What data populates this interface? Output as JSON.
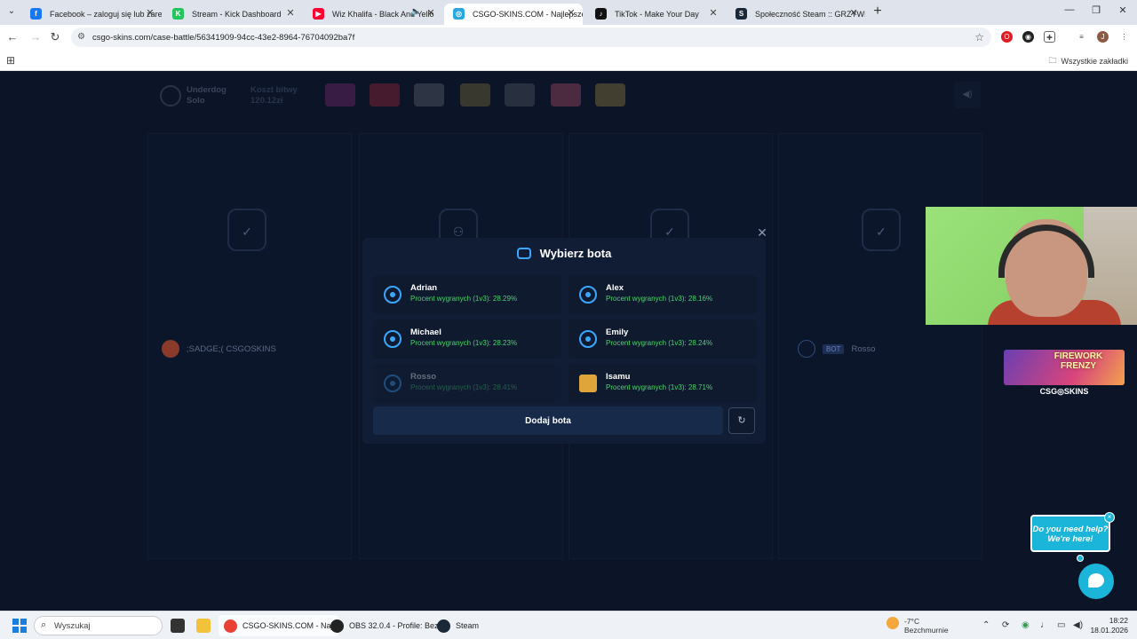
{
  "browser": {
    "tabs": [
      {
        "title": "Facebook – zaloguj się lub zarej",
        "favicon_color": "#1877f2",
        "favicon_glyph": "f",
        "active": false
      },
      {
        "title": "Stream - Kick Dashboard",
        "favicon_color": "#21c65d",
        "favicon_glyph": "K",
        "active": false
      },
      {
        "title": "Wiz Khalifa - Black And Yello",
        "favicon_color": "#ff0033",
        "favicon_glyph": "▶",
        "active": false
      },
      {
        "title": "CSGO-SKINS.COM - Najlepsze",
        "favicon_color": "#2aa6e0",
        "favicon_glyph": "◎",
        "active": true
      },
      {
        "title": "TikTok - Make Your Day",
        "favicon_color": "#111111",
        "favicon_glyph": "♪",
        "active": false
      },
      {
        "title": "Społeczność Steam :: GRZYWIA",
        "favicon_color": "#1b2838",
        "favicon_glyph": "S",
        "active": false
      }
    ],
    "url": "csgo-skins.com/case-battle/56341909-94cc-43e2-8964-76704092ba7f",
    "bookmarks_label": "Wszystkie zakładki"
  },
  "battle": {
    "mode_line1": "Underdog",
    "mode_line2": "Solo",
    "cost_label": "Koszt bitwy",
    "cost_value": "120.12zł",
    "players": [
      {
        "name": ";SADGE;( CSGOSKINS"
      },
      {
        "bot_tag": "BOT",
        "name": "Rosso"
      }
    ]
  },
  "modal": {
    "title": "Wybierz bota",
    "bots": [
      {
        "name": "Adrian",
        "rate": "Procent wygranych (1v3): 28.29%",
        "disabled": false
      },
      {
        "name": "Alex",
        "rate": "Procent wygranych (1v3): 28.16%",
        "disabled": false
      },
      {
        "name": "Michael",
        "rate": "Procent wygranych (1v3): 28.23%",
        "disabled": false
      },
      {
        "name": "Emily",
        "rate": "Procent wygranych (1v3): 28.24%",
        "disabled": false
      },
      {
        "name": "Rosso",
        "rate": "Procent wygranych (1v3): 28.41%",
        "disabled": true
      },
      {
        "name": "Isamu",
        "rate": "Procent wygranych (1v3): 28.71%",
        "disabled": false
      }
    ],
    "add_button": "Dodaj bota"
  },
  "overlays": {
    "promo_title": "FIREWORK FRENZY",
    "promo_brand": "CSG◎SKINS",
    "help_text": "Do you need help? We're here!"
  },
  "taskbar": {
    "search_placeholder": "Wyszukaj",
    "apps": [
      {
        "label": "CSGO-SKINS.COM - Naj",
        "color": "#e94235"
      },
      {
        "label": "OBS 32.0.4 - Profile: Bez",
        "color": "#222222"
      },
      {
        "label": "Steam",
        "color": "#1b2838"
      }
    ],
    "weather_temp": "-7°C",
    "weather_desc": "Bezchmurnie",
    "time": "18:22",
    "date": "18.01.2026"
  },
  "colors": {
    "accent_blue": "#3aa7ff",
    "win_rate_green": "#4ad46c",
    "page_bg": "#0c1528"
  }
}
